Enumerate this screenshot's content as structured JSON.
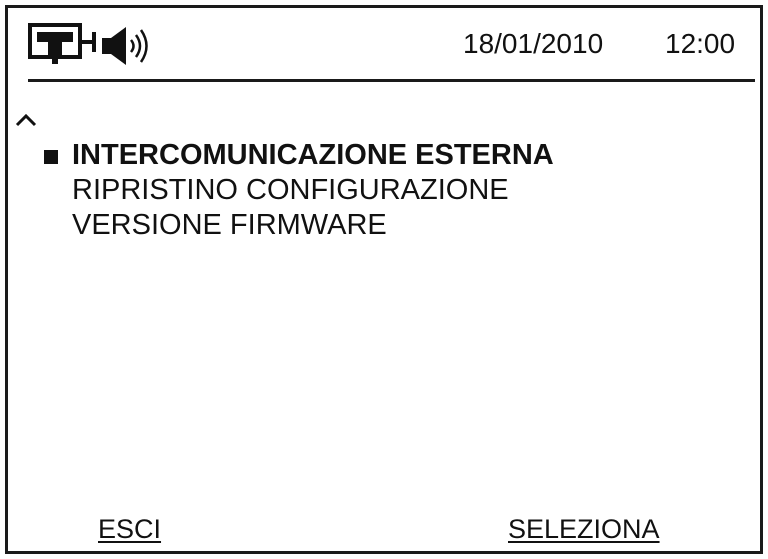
{
  "status_bar": {
    "network_icon": "network-connection-icon",
    "speaker_icon": "speaker-volume-icon",
    "date": "18/01/2010",
    "time": "12:00"
  },
  "navigation": {
    "scroll_up_icon": "chevron-up-icon"
  },
  "menu": {
    "selected_index": 0,
    "items": [
      {
        "label": "INTERCOMUNICAZIONE ESTERNA"
      },
      {
        "label": "RIPRISTINO CONFIGURAZIONE"
      },
      {
        "label": "VERSIONE FIRMWARE"
      }
    ]
  },
  "softkeys": {
    "left_label": "ESCI",
    "right_label": "SELEZIONA"
  }
}
